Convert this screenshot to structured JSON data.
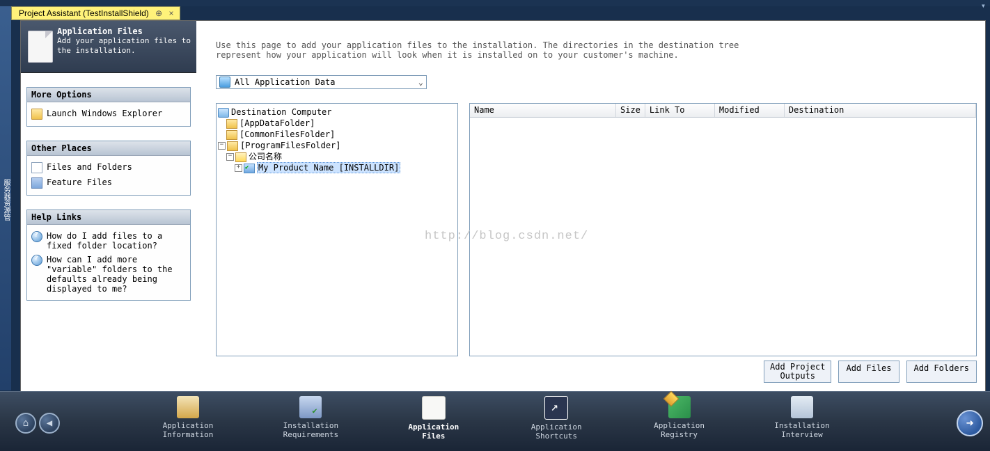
{
  "tab": {
    "title": "Project Assistant (TestInstallShield)"
  },
  "banner": {
    "title": "Application Files",
    "desc": "Add your application files to the installation."
  },
  "panels": {
    "more_options": {
      "header": "More Options",
      "launch_explorer": "Launch Windows Explorer"
    },
    "other_places": {
      "header": "Other Places",
      "files_folders": "Files and Folders",
      "feature_files": "Feature Files"
    },
    "help_links": {
      "header": "Help Links",
      "q1": "How do I add files to a fixed folder location?",
      "q2": "How can I add more \"variable\" folders to the defaults already being displayed to me?"
    }
  },
  "main": {
    "desc1": "Use this page to add your application files to the installation. The directories in the destination tree",
    "desc2": "represent how your application will look when it is installed on to your customer's machine.",
    "dropdown": "All Application Data"
  },
  "tree": {
    "root": "Destination Computer",
    "appdata": "[AppDataFolder]",
    "commonfiles": "[CommonFilesFolder]",
    "programfiles": "[ProgramFilesFolder]",
    "company": "公司名称",
    "product": "My Product Name [INSTALLDIR]"
  },
  "list": {
    "col_name": "Name",
    "col_size": "Size",
    "col_link": "Link To",
    "col_mod": "Modified",
    "col_dest": "Destination"
  },
  "buttons": {
    "add_outputs_l1": "Add Project",
    "add_outputs_l2": "Outputs",
    "add_files": "Add Files",
    "add_folders": "Add Folders"
  },
  "nav": {
    "app_info_l1": "Application",
    "app_info_l2": "Information",
    "inst_req_l1": "Installation",
    "inst_req_l2": "Requirements",
    "app_files_l1": "Application",
    "app_files_l2": "Files",
    "app_short_l1": "Application",
    "app_short_l2": "Shortcuts",
    "app_reg_l1": "Application",
    "app_reg_l2": "Registry",
    "inst_int_l1": "Installation",
    "inst_int_l2": "Interview"
  },
  "watermark": "http://blog.csdn.net/"
}
